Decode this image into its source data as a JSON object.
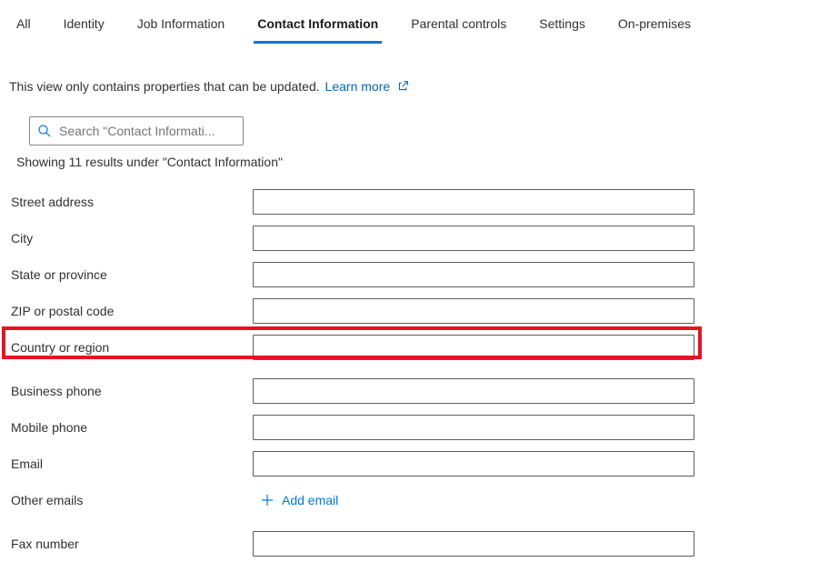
{
  "tabs": {
    "all": "All",
    "identity": "Identity",
    "job": "Job Information",
    "contact": "Contact Information",
    "parental": "Parental controls",
    "settings": "Settings",
    "onprem": "On-premises"
  },
  "info": {
    "text": "This view only contains properties that can be updated.",
    "learn_more": "Learn more"
  },
  "search": {
    "placeholder": "Search \"Contact Informati..."
  },
  "results_text": "Showing 11 results under \"Contact Information\"",
  "fields": {
    "street": "Street address",
    "city": "City",
    "state": "State or province",
    "zip": "ZIP or postal code",
    "country": "Country or region",
    "business_phone": "Business phone",
    "mobile_phone": "Mobile phone",
    "email": "Email",
    "other_emails": "Other emails",
    "fax": "Fax number"
  },
  "add_email_label": "Add email"
}
